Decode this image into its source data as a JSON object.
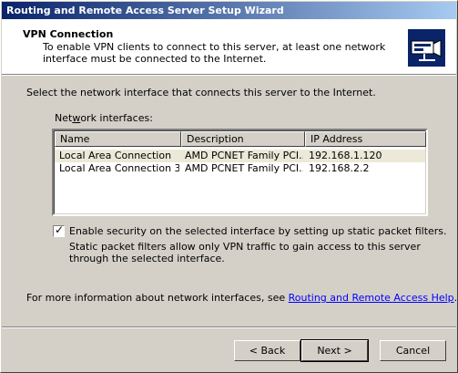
{
  "window": {
    "title": "Routing and Remote Access Server Setup Wizard"
  },
  "header": {
    "title": "VPN Connection",
    "description": "To enable VPN clients to connect to this server, at least one network interface must be connected to the Internet.",
    "icon": "network-wizard-icon"
  },
  "body": {
    "prompt": "Select the network interface that connects this server to the Internet.",
    "interfaces_label": "Network interfaces:",
    "columns": [
      "Name",
      "Description",
      "IP Address"
    ],
    "rows": [
      {
        "name": "Local Area Connection",
        "description": "AMD PCNET Family PCI...",
        "ip": "192.168.1.120"
      },
      {
        "name": "Local Area Connection 3",
        "description": "AMD PCNET Family PCI...",
        "ip": "192.168.2.2"
      }
    ],
    "selected_row": 0,
    "security_checkbox": {
      "checked": true,
      "label": "Enable security on the selected interface by setting up static packet filters.",
      "description": "Static packet filters allow only VPN traffic to gain access to this server through the selected interface."
    },
    "info_prefix": "For more information about network interfaces, see ",
    "info_link": "Routing and Remote Access Help",
    "info_suffix": "."
  },
  "buttons": {
    "back": "< Back",
    "next": "Next >",
    "cancel": "Cancel"
  },
  "colors": {
    "titlebar_start": "#0a246a",
    "titlebar_end": "#a6caf0",
    "dialog_bg": "#d4d0c8",
    "link": "#0000ff"
  }
}
